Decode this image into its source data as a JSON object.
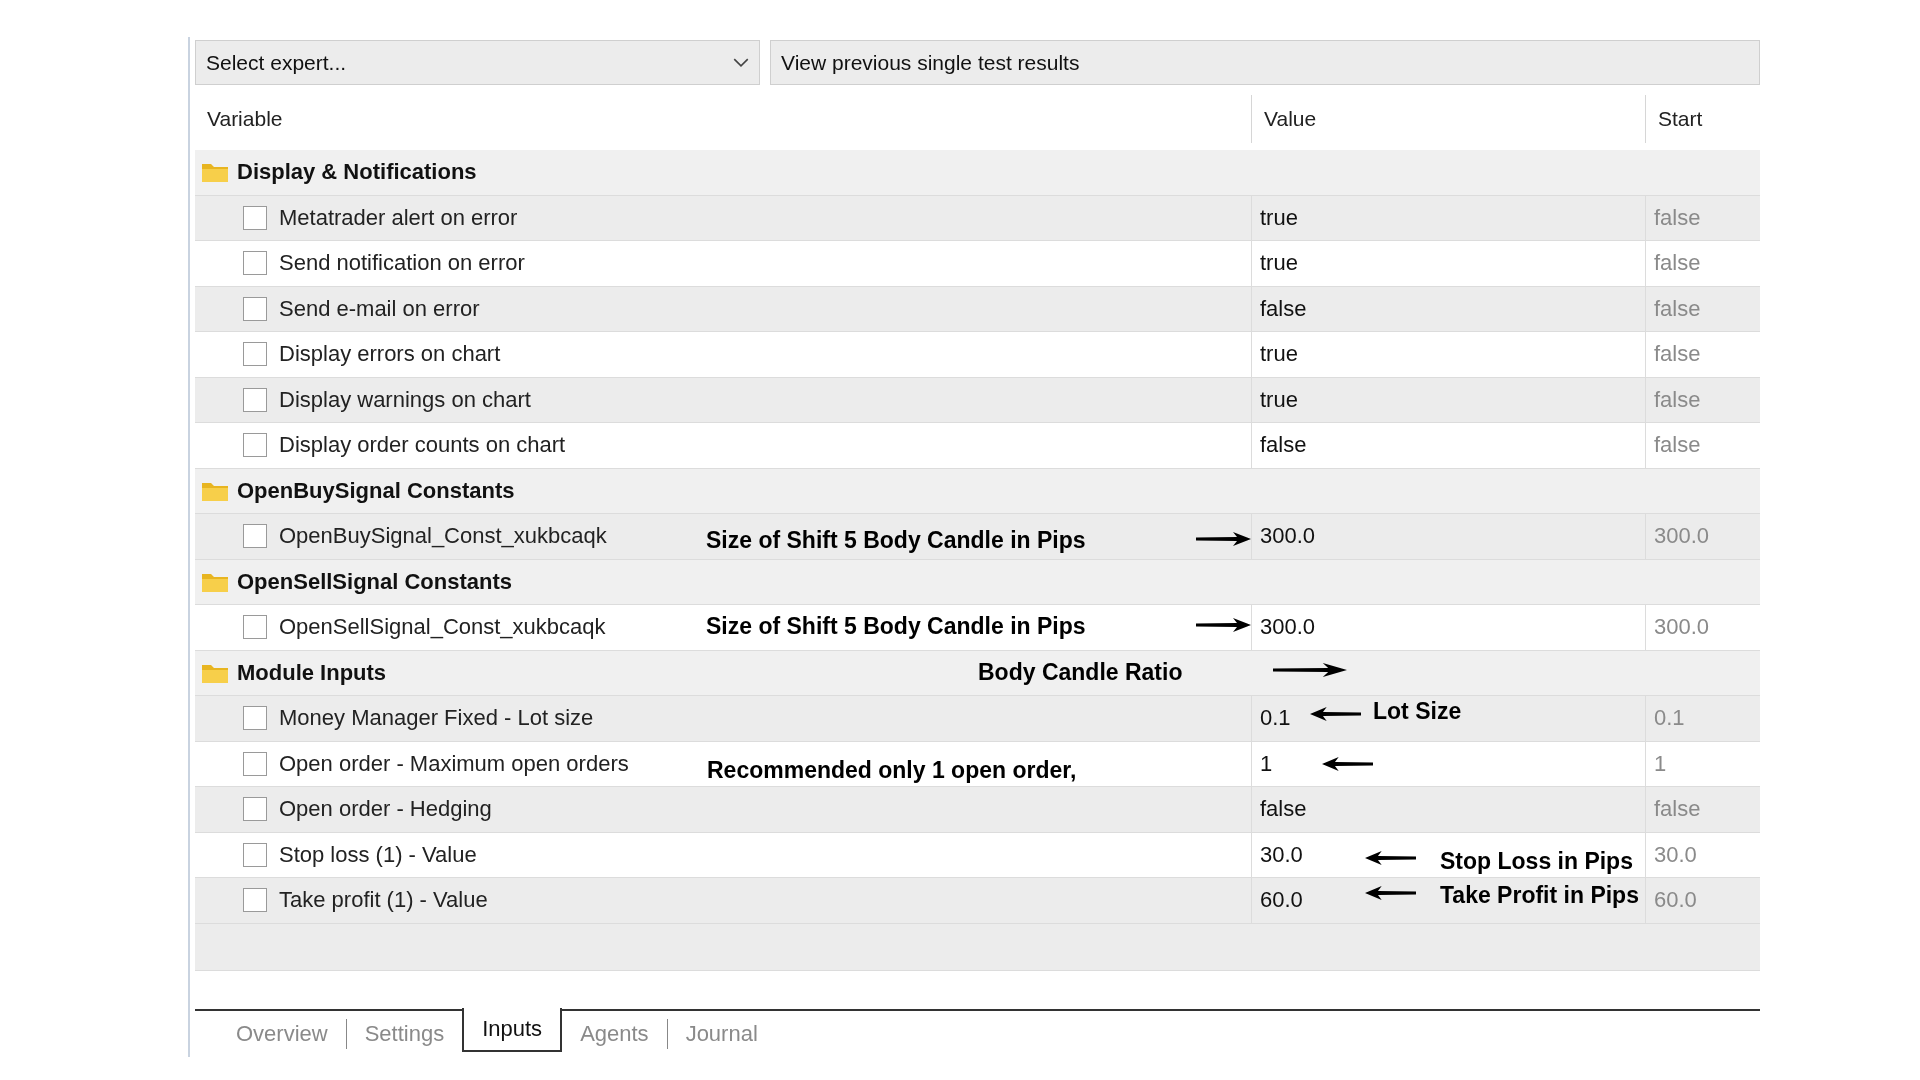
{
  "toolbar": {
    "expert_select": {
      "value": "Select expert..."
    },
    "view_button": "View previous single test results"
  },
  "table": {
    "columns": [
      "Variable",
      "Value",
      "Start"
    ],
    "groups": [
      {
        "name": "Display & Notifications",
        "rows": [
          {
            "name": "Metatrader alert on error",
            "checked": false,
            "value": "true",
            "start": "false"
          },
          {
            "name": "Send notification on error",
            "checked": false,
            "value": "true",
            "start": "false"
          },
          {
            "name": "Send e-mail on error",
            "checked": false,
            "value": "false",
            "start": "false"
          },
          {
            "name": "Display errors on chart",
            "checked": false,
            "value": "true",
            "start": "false"
          },
          {
            "name": "Display warnings on chart",
            "checked": false,
            "value": "true",
            "start": "false"
          },
          {
            "name": "Display order counts on chart",
            "checked": false,
            "value": "false",
            "start": "false"
          }
        ]
      },
      {
        "name": "OpenBuySignal Constants",
        "rows": [
          {
            "name": "OpenBuySignal_Const_xukbcaqk",
            "checked": false,
            "value": "300.0",
            "start": "300.0"
          }
        ]
      },
      {
        "name": "OpenSellSignal Constants",
        "rows": [
          {
            "name": "OpenSellSignal_Const_xukbcaqk",
            "checked": false,
            "value": "300.0",
            "start": "300.0"
          }
        ]
      },
      {
        "name": "Module Inputs",
        "rows": [
          {
            "name": "Money Manager Fixed - Lot size",
            "checked": false,
            "value": "0.1",
            "start": "0.1"
          },
          {
            "name": "Open order - Maximum open orders",
            "checked": false,
            "value": "1",
            "start": "1"
          },
          {
            "name": "Open order - Hedging",
            "checked": false,
            "value": "false",
            "start": "false"
          },
          {
            "name": "Stop loss (1) - Value",
            "checked": false,
            "value": "30.0",
            "start": "30.0"
          },
          {
            "name": "Take profit (1) - Value",
            "checked": false,
            "value": "60.0",
            "start": "60.0"
          }
        ]
      }
    ]
  },
  "annotations": [
    {
      "text": "Size of Shift 5 Body Candle in Pips"
    },
    {
      "text": "Size of Shift 5 Body Candle in Pips"
    },
    {
      "text": "Body Candle Ratio"
    },
    {
      "text": "Lot Size"
    },
    {
      "text": "Recommended only 1 open order,"
    },
    {
      "text": "Stop Loss in Pips"
    },
    {
      "text": "Take Profit in Pips"
    }
  ],
  "tabs": [
    {
      "label": "Overview",
      "selected": false
    },
    {
      "label": "Settings",
      "selected": false
    },
    {
      "label": "Inputs",
      "selected": true
    },
    {
      "label": "Agents",
      "selected": false
    },
    {
      "label": "Journal",
      "selected": false
    }
  ]
}
